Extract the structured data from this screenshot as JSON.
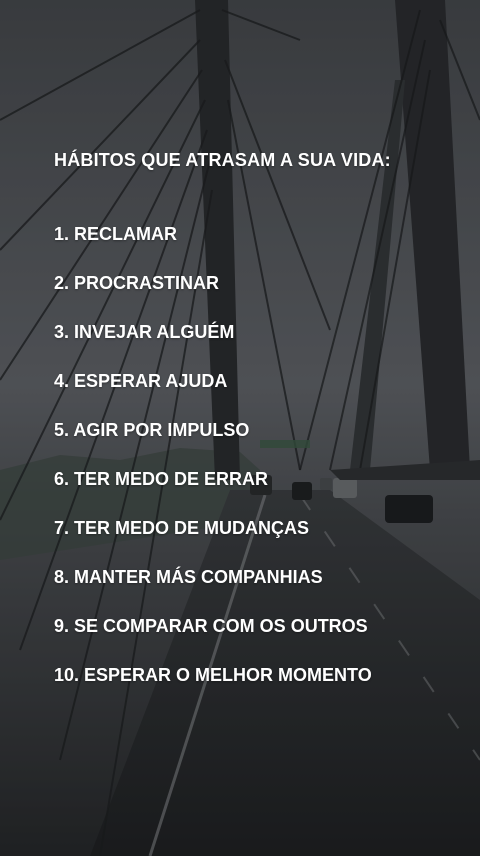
{
  "heading": "HÁBITOS QUE ATRASAM A SUA VIDA:",
  "habits": [
    "1. RECLAMAR",
    "2. PROCRASTINAR",
    "3. INVEJAR ALGUÉM",
    "4. ESPERAR AJUDA",
    "5. AGIR POR IMPULSO",
    "6. TER MEDO DE ERRAR",
    "7. TER MEDO DE MUDANÇAS",
    "8. MANTER MÁS COMPANHIAS",
    "9. SE COMPARAR COM OS OUTROS",
    "10. ESPERAR O MELHOR MOMENTO"
  ],
  "colors": {
    "text": "#ffffff",
    "sky": "#5c5f63",
    "road": "#2e3033",
    "tower": "#2b2d30"
  }
}
